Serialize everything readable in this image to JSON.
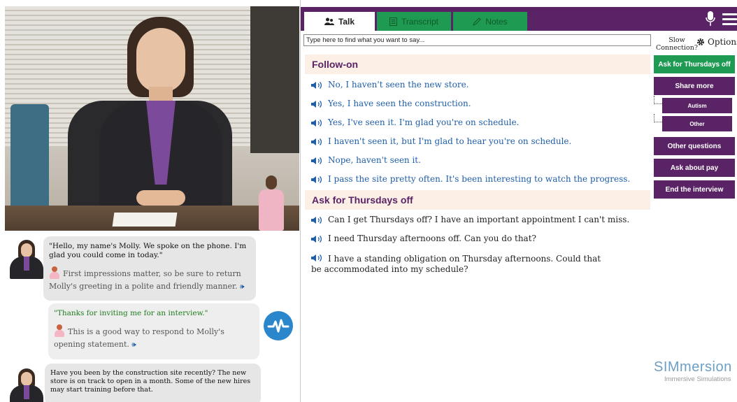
{
  "tabs": [
    {
      "label": "Talk",
      "icon": "users-icon"
    },
    {
      "label": "Transcript",
      "icon": "document-icon"
    },
    {
      "label": "Notes",
      "icon": "pencil-icon"
    }
  ],
  "search": {
    "placeholder": "Type here to find what you want to say..."
  },
  "slow_connection": {
    "line1": "Slow",
    "line2": "Connection?"
  },
  "options_label": "Options",
  "sections": [
    {
      "title": "Follow-on",
      "options": [
        "No, I haven't seen the new store.",
        "Yes, I have seen the construction.",
        "Yes, I've seen it. I'm glad you're on schedule.",
        "I haven't seen it, but I'm glad to hear you're on schedule.",
        "Nope, haven't seen it.",
        "I pass the site pretty often. It's been interesting to watch the progress."
      ]
    },
    {
      "title": "Ask for Thursdays off",
      "options": [
        "Can I get Thursdays off? I have an important appointment I can't miss.",
        "I need Thursday afternoons off. Can you do that?",
        "I have a standing obligation on Thursday afternoons. Could that be accommodated into my schedule?"
      ]
    }
  ],
  "sidebar": {
    "ask_thursdays": "Ask for Thursdays off",
    "share_more": "Share more",
    "autism": "Autism",
    "other": "Other",
    "other_questions": "Other questions",
    "ask_pay": "Ask about pay",
    "end_interview": "End the interview"
  },
  "chat": {
    "m1_text": "\"Hello, my name's Molly. We spoke on the phone. I'm glad you could come in today.\"",
    "m1_hint": "First impressions matter, so be sure to return Molly's greeting in a polite and friendly manner.",
    "u1_text": "\"Thanks for inviting me for an interview.\"",
    "u1_hint": "This is a good way to respond to Molly's opening statement.",
    "m2_text": "Have you been by the construction site recently? The new store is on track to open in a month. Some of the new hires may start training before that."
  },
  "logo": {
    "main": "SIMmersion",
    "sub": "Immersive Simulations"
  },
  "colors": {
    "purple": "#5a2366",
    "green": "#1f9a52",
    "link_blue": "#1f5ea8",
    "section_bg": "#fcefe6"
  }
}
